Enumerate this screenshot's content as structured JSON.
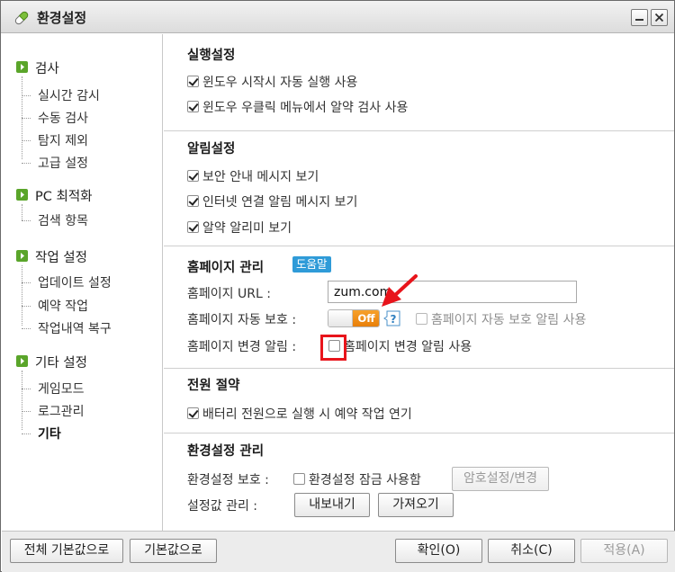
{
  "window": {
    "title": "환경설정"
  },
  "sidebar": {
    "groups": [
      {
        "label": "검사",
        "items": [
          "실시간 감시",
          "수동 검사",
          "탐지 제외",
          "고급 설정"
        ]
      },
      {
        "label": "PC 최적화",
        "items": [
          "검색 항목"
        ]
      },
      {
        "label": "작업 설정",
        "items": [
          "업데이트 설정",
          "예약 작업",
          "작업내역 복구"
        ]
      },
      {
        "label": "기타 설정",
        "items": [
          "게임모드",
          "로그관리",
          "기타"
        ]
      }
    ],
    "active_item": "기타"
  },
  "sections": {
    "run": {
      "title": "실행설정",
      "options": [
        {
          "label": "윈도우 시작시 자동 실행 사용",
          "checked": true
        },
        {
          "label": "윈도우 우클릭 메뉴에서 알약 검사 사용",
          "checked": true
        }
      ]
    },
    "alert": {
      "title": "알림설정",
      "options": [
        {
          "label": "보안 안내 메시지 보기",
          "checked": true
        },
        {
          "label": "인터넷 연결 알림 메시지 보기",
          "checked": true
        },
        {
          "label": "알약 알리미 보기",
          "checked": true
        }
      ]
    },
    "homepage": {
      "title": "홈페이지 관리",
      "help_label": "도움말",
      "url_label": "홈페이지 URL :",
      "url_value": "zum.com",
      "protect_label": "홈페이지 자동 보호 :",
      "toggle_state": "Off",
      "protect_alert_label": "홈페이지 자동 보호 알림 사용",
      "protect_alert_checked": false,
      "change_label": "홈페이지 변경 알림 :",
      "change_alert_label": "홈페이지 변경 알림 사용",
      "change_alert_checked": false
    },
    "power": {
      "title": "전원 절약",
      "options": [
        {
          "label": "배터리 전원으로 실행 시 예약 작업 연기",
          "checked": true
        }
      ]
    },
    "settings": {
      "title": "환경설정 관리",
      "protect_label": "환경설정 보호 :",
      "lock_label": "환경설정 잠금 사용함",
      "lock_checked": false,
      "password_button": "암호설정/변경",
      "manage_label": "설정값 관리 :",
      "export_button": "내보내기",
      "import_button": "가져오기"
    }
  },
  "footer": {
    "reset_all": "전체 기본값으로",
    "reset": "기본값으로",
    "ok": "확인(O)",
    "cancel": "취소(C)",
    "apply": "적용(A)"
  },
  "colors": {
    "accent_blue": "#2f9bd8",
    "toggle_orange": "#f08c17",
    "highlight_red": "#e8141b",
    "group_icon_green": "#5aa52a"
  }
}
